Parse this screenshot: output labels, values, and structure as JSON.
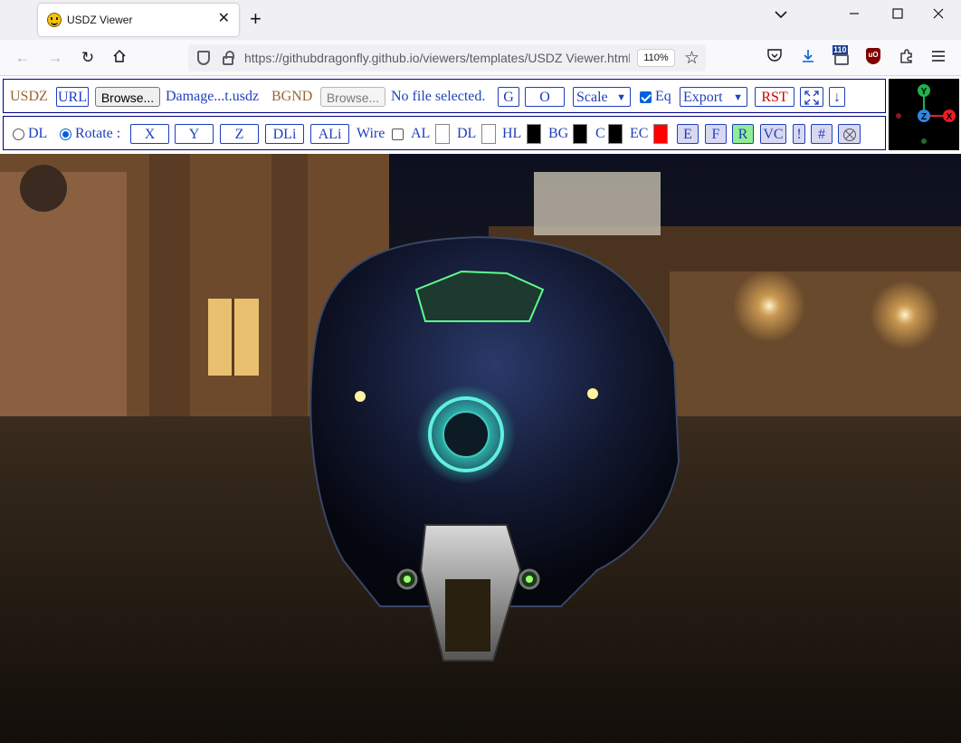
{
  "browser": {
    "tab_title": "USDZ Viewer",
    "url": "https://githubdragonfly.github.io/viewers/templates/USDZ Viewer.html",
    "zoom": "110%",
    "ext_badge": "110",
    "ublock_label": "uO"
  },
  "toolbar1": {
    "usdz_label": "USDZ",
    "url_button": "URL",
    "browse_button": "Browse...",
    "file_name": "Damage...t.usdz",
    "bgnd_label": "BGND",
    "bgnd_browse_button": "Browse...",
    "bgnd_file_status": "No file selected.",
    "g_button": "G",
    "o_button": "O",
    "scale_select": "Scale",
    "eq_label": "Eq",
    "export_select": "Export",
    "rst_button": "RST",
    "fullscreen_icon": "expand-icon",
    "down_button": "↓"
  },
  "toolbar2": {
    "dl_radio_label": "DL",
    "rotate_radio_label": "Rotate :",
    "rotate_selected": "Rotate",
    "x_button": "X",
    "y_button": "Y",
    "z_button": "Z",
    "dli_button": "DLi",
    "ali_button": "ALi",
    "wire_label": "Wire",
    "al_label": "AL",
    "dl_label": "DL",
    "hl_label": "HL",
    "bg_label": "BG",
    "c_label": "C",
    "ec_label": "EC",
    "e_button": "E",
    "f_button": "F",
    "r_button": "R",
    "vc_button": "VC",
    "bang_button": "!",
    "hash_button": "#",
    "hl_color": "#000000",
    "bg_color": "#000000",
    "c_color": "#000000",
    "ec_color": "#ff0000"
  },
  "gizmo": {
    "y_label": "Y",
    "x_label": "X",
    "z_label": "Z",
    "y_color": "#22b14c",
    "x_color": "#ed1c24",
    "z_color": "#2f87e0"
  },
  "colors": {
    "toolbar_border": "#000080",
    "toolbar_text": "#1f3fbf",
    "label_text": "#996633",
    "r_button_bg": "#90ee90",
    "pressed_button_bg": "#d8d8f0"
  }
}
